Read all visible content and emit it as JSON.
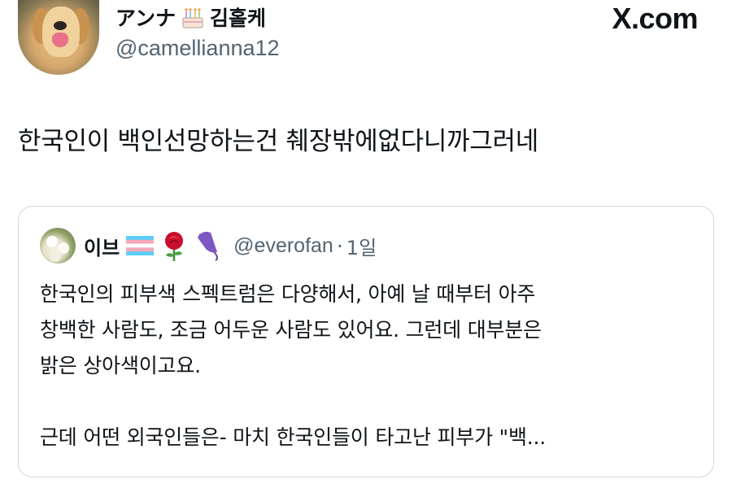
{
  "author": {
    "display_name": "アンナ",
    "display_name_suffix": "김홀케",
    "handle": "@camellianna12",
    "avatar_icon": "golden-retriever-avatar",
    "name_emoji_icon": "birthday-cake-icon"
  },
  "brand": {
    "label": "X.com"
  },
  "tweet": {
    "text": "한국인이 백인선망하는건 췌장밖에없다니까그러네"
  },
  "quote": {
    "display_name": "이브",
    "handle": "@everofan",
    "separator": "·",
    "time": "1일",
    "icons": [
      "transgender-flag-icon",
      "rose-icon",
      "umbrella-icon"
    ],
    "lines": [
      "한국인의 피부색 스펙트럼은 다양해서, 아예 날 때부터 아주",
      "창백한 사람도, 조금 어두운 사람도 있어요. 그런데 대부분은",
      "밝은 상아색이고요."
    ],
    "last_line": "근데 어떤 외국인들은- 마치 한국인들이 타고난 피부가 \"백..."
  },
  "colors": {
    "text_primary": "#0f1419",
    "text_secondary": "#536471",
    "border": "#cfd9de",
    "background": "#ffffff"
  }
}
